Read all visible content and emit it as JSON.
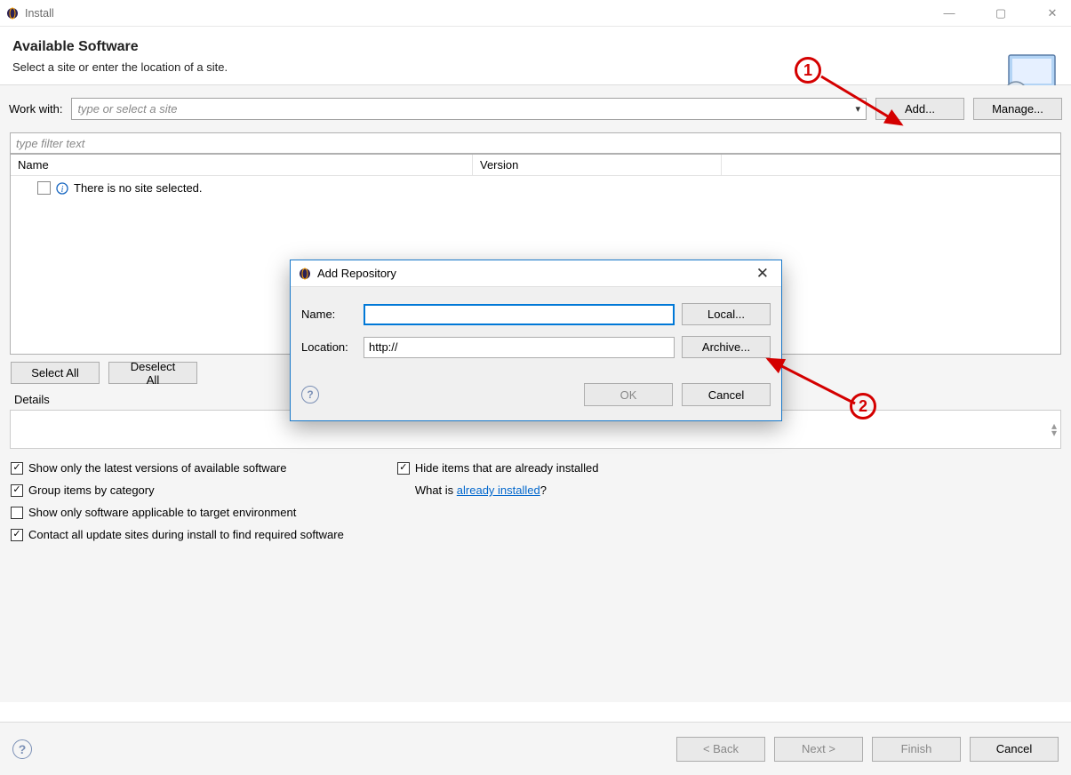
{
  "window": {
    "title": "Install",
    "controls": {
      "min": "—",
      "max": "▢",
      "close": "✕"
    }
  },
  "header": {
    "title": "Available Software",
    "subtitle": "Select a site or enter the location of a site."
  },
  "workwith": {
    "label": "Work with:",
    "placeholder": "type or select a site",
    "add": "Add...",
    "manage": "Manage..."
  },
  "filter": {
    "placeholder": "type filter text"
  },
  "tree": {
    "cols": {
      "name": "Name",
      "version": "Version"
    },
    "row_msg": "There is no site selected."
  },
  "selectAll": "Select All",
  "deselectAll": "Deselect All",
  "detailsLabel": "Details",
  "options": {
    "latest": "Show only the latest versions of available software",
    "group": "Group items by category",
    "target": "Show only software applicable to target environment",
    "contact": "Contact all update sites during install to find required software",
    "hide": "Hide items that are already installed",
    "whatPrefix": "What is ",
    "whatLink": "already installed",
    "whatSuffix": "?"
  },
  "footer": {
    "back": "< Back",
    "next": "Next >",
    "finish": "Finish",
    "cancel": "Cancel"
  },
  "dialog": {
    "title": "Add Repository",
    "nameLabel": "Name:",
    "nameValue": "",
    "locationLabel": "Location:",
    "locationValue": "http://",
    "local": "Local...",
    "archive": "Archive...",
    "ok": "OK",
    "cancel": "Cancel"
  },
  "annotations": {
    "one": "1",
    "two": "2"
  }
}
